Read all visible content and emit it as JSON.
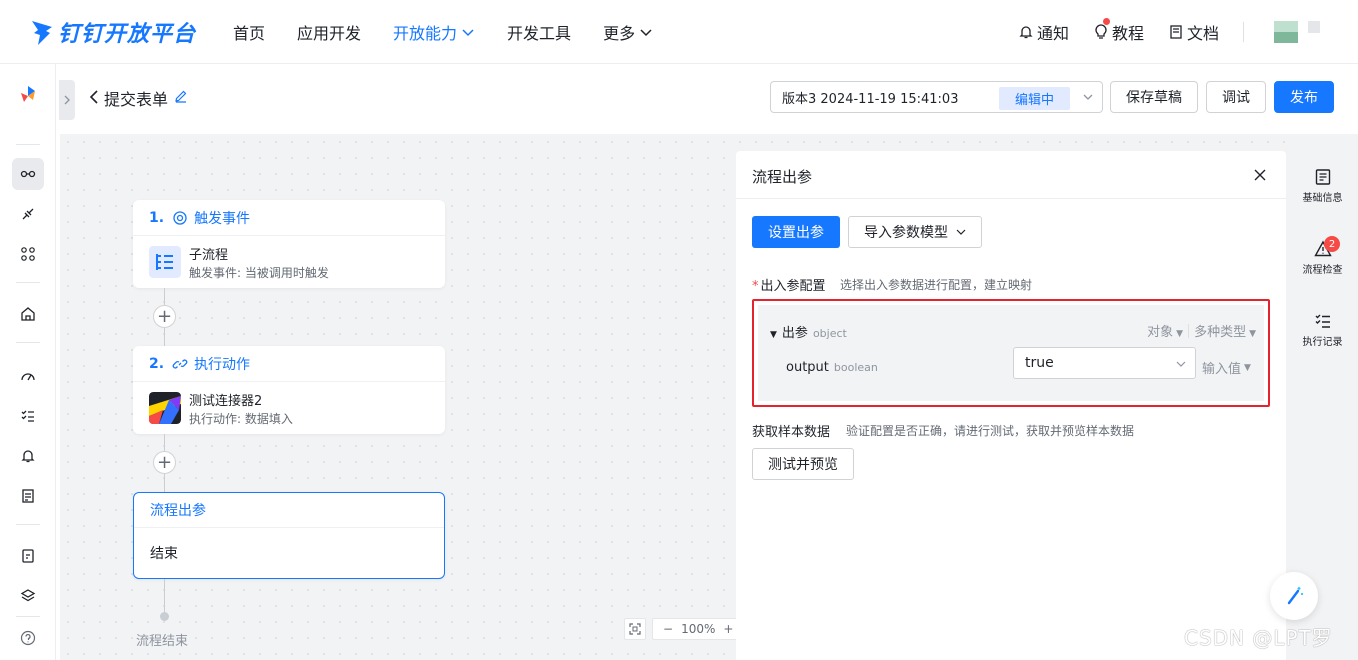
{
  "brand": {
    "name": "钉钉开放平台"
  },
  "nav": {
    "items": [
      {
        "label": "首页",
        "active": false,
        "dropdown": false
      },
      {
        "label": "应用开发",
        "active": false,
        "dropdown": false
      },
      {
        "label": "开放能力",
        "active": true,
        "dropdown": true
      },
      {
        "label": "开发工具",
        "active": false,
        "dropdown": false
      },
      {
        "label": "更多",
        "active": false,
        "dropdown": true
      }
    ],
    "right": {
      "notify": "通知",
      "tutorial": "教程",
      "docs": "文档"
    }
  },
  "header": {
    "title": "提交表单",
    "version_text": "版本3 2024-11-19 15:41:03",
    "version_status": "编辑中",
    "save_draft": "保存草稿",
    "debug": "调试",
    "publish": "发布"
  },
  "flow": {
    "trigger": {
      "num": "1.",
      "title": "触发事件",
      "name": "子流程",
      "desc": "触发事件: 当被调用时触发"
    },
    "action": {
      "num": "2.",
      "title": "执行动作",
      "name": "测试连接器2",
      "desc": "执行动作: 数据填入"
    },
    "end_node": {
      "title": "流程出参",
      "body": "结束"
    },
    "end_label": "流程结束",
    "zoom": "100%"
  },
  "panel": {
    "title": "流程出参",
    "btn_set": "设置出参",
    "btn_import": "导入参数模型",
    "config_label": "出入参配置",
    "config_hint": "选择出入参数据进行配置，建立映射",
    "param_name": "出参",
    "param_type": "object",
    "param_kind": "对象",
    "param_multi": "多种类型",
    "child_name": "output",
    "child_type": "boolean",
    "child_value": "true",
    "child_mode": "输入值",
    "sample_label": "获取样本数据",
    "sample_hint": "验证配置是否正确，请进行测试，获取并预览样本数据",
    "btn_test": "测试并预览"
  },
  "sidetools": {
    "basic": "基础信息",
    "check": "流程检查",
    "check_count": "2",
    "log": "执行记录"
  },
  "watermark": "CSDN @LPT罗",
  "colors": {
    "accent": "#1677ff",
    "highlight": "#e5232e",
    "badge": "#f54a45"
  }
}
